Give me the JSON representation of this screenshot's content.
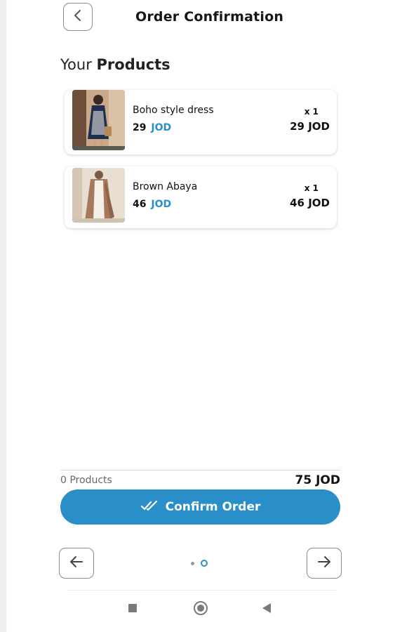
{
  "header": {
    "title": "Order Confirmation",
    "back_icon": "chevron-left-icon"
  },
  "section": {
    "prefix": "Your",
    "strong": "Products"
  },
  "products": [
    {
      "name": "Boho style dress",
      "price": "29",
      "currency": "JOD",
      "qty": "x 1",
      "total": "29 JOD",
      "image": "dress-photo"
    },
    {
      "name": "Brown Abaya",
      "price": "46",
      "currency": "JOD",
      "qty": "x 1",
      "total": "46 JOD",
      "image": "abaya-photo"
    }
  ],
  "summary": {
    "count": "0 Products",
    "total": "75 JOD"
  },
  "confirm": {
    "label": "Confirm Order",
    "icon": "double-check-icon"
  },
  "pager": {
    "prev_icon": "arrow-left-icon",
    "next_icon": "arrow-right-icon"
  },
  "colors": {
    "accent": "#2a8fc9",
    "text": "#111111",
    "muted": "#666666"
  }
}
